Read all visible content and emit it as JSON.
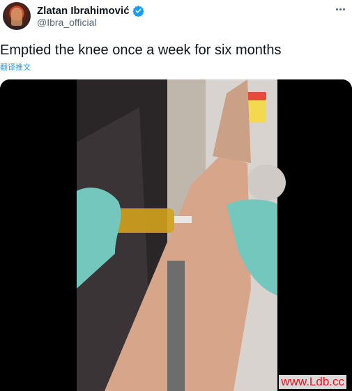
{
  "tweet": {
    "display_name": "Zlatan Ibrahimović",
    "handle": "@Ibra_official",
    "text": "Emptied the knee once a week for six months",
    "translate_label": "翻译推文",
    "more_icon": "more-horizontal-icon",
    "verified_icon": "verified-badge-icon"
  },
  "media": {
    "description_icon": "video-frame",
    "watermark": "www.Ldb.cc"
  },
  "colors": {
    "accent": "#1d9bf0",
    "text": "#0f1419",
    "secondary": "#536471",
    "watermark": "#e0141e"
  }
}
